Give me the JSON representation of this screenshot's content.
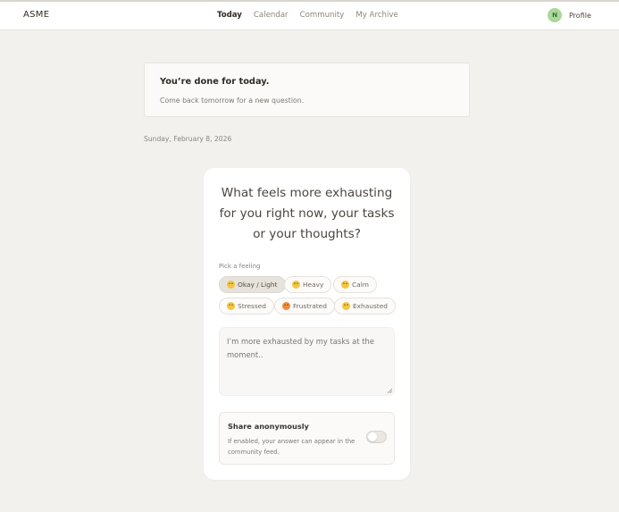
{
  "nav": {
    "brand": "ASME",
    "links": [
      {
        "label": "Today",
        "active": true
      },
      {
        "label": "Calendar",
        "active": false
      },
      {
        "label": "Community",
        "active": false
      },
      {
        "label": "My Archive",
        "active": false
      }
    ],
    "avatar_initial": "N",
    "profile_label": "Profile"
  },
  "notice": {
    "title": "You’re done for today.",
    "subtitle": "Come back tomorrow for a new question."
  },
  "date": "Sunday, February 8, 2026",
  "question": {
    "text": "What feels more exhausting for you right now, your tasks or your thoughts?",
    "pick_label": "Pick a feeling",
    "feelings": [
      {
        "label": "Okay / Light",
        "selected": true
      },
      {
        "label": "Heavy",
        "selected": false
      },
      {
        "label": "Calm",
        "selected": false
      },
      {
        "label": "Stressed",
        "selected": false
      },
      {
        "label": "Frustrated",
        "selected": false
      },
      {
        "label": "Exhausted",
        "selected": false
      }
    ],
    "answer": "I’m more exhausted by my tasks at the moment..",
    "share": {
      "title": "Share anonymously",
      "description": "If enabled, your answer can appear in the community feed.",
      "enabled": false
    }
  },
  "colors": {
    "background": "#f2f1ee",
    "card": "#ffffff",
    "avatar": "#a9d89a",
    "chip_selected": "#e6e2dc"
  }
}
